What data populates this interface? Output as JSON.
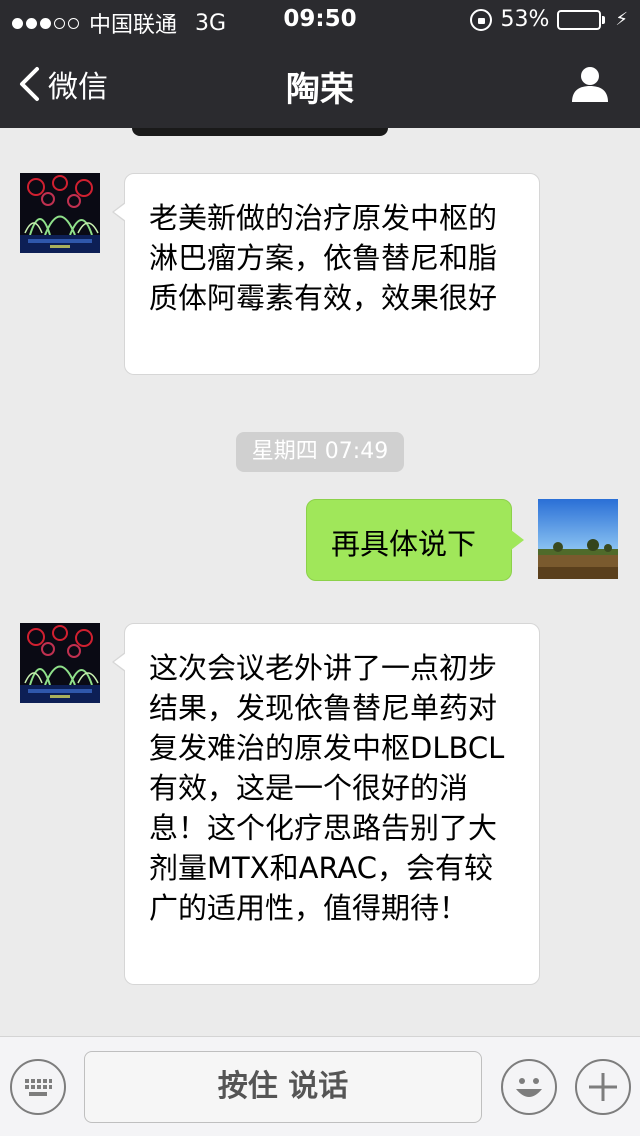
{
  "status_bar": {
    "carrier": "中国联通",
    "network": "3G",
    "time": "09:50",
    "battery": "53%",
    "battery_level": 0.53,
    "battery_color": "#4cd964"
  },
  "nav": {
    "back_label": "微信",
    "title": "陶荣",
    "back_icon": "chevron-left-icon",
    "profile_icon": "person-icon"
  },
  "messages": [
    {
      "side": "left",
      "text": "老美新做的治疗原发中枢的淋巴瘤方案，依鲁替尼和脂质体阿霉素有效，效果很好"
    },
    {
      "side": "right",
      "text": "再具体说下"
    },
    {
      "side": "left",
      "text": "这次会议老外讲了一点初步结果，发现依鲁替尼单药对复发难治的原发中枢DLBCL有效，这是一个很好的消息！这个化疗思路告别了大剂量MTX和ARAC，会有较广的适用性，值得期待！"
    }
  ],
  "timestamp": "星期四 07:49",
  "input_bar": {
    "hold_to_talk": "按住 说话",
    "keyboard_icon": "keyboard-icon",
    "emoji_icon": "emoji-icon",
    "add_icon": "plus-icon"
  },
  "colors": {
    "nav_background": "#2b2b2f",
    "chat_background": "#ebebeb",
    "sent_bubble": "#a0e75a",
    "received_bubble": "#ffffff"
  }
}
